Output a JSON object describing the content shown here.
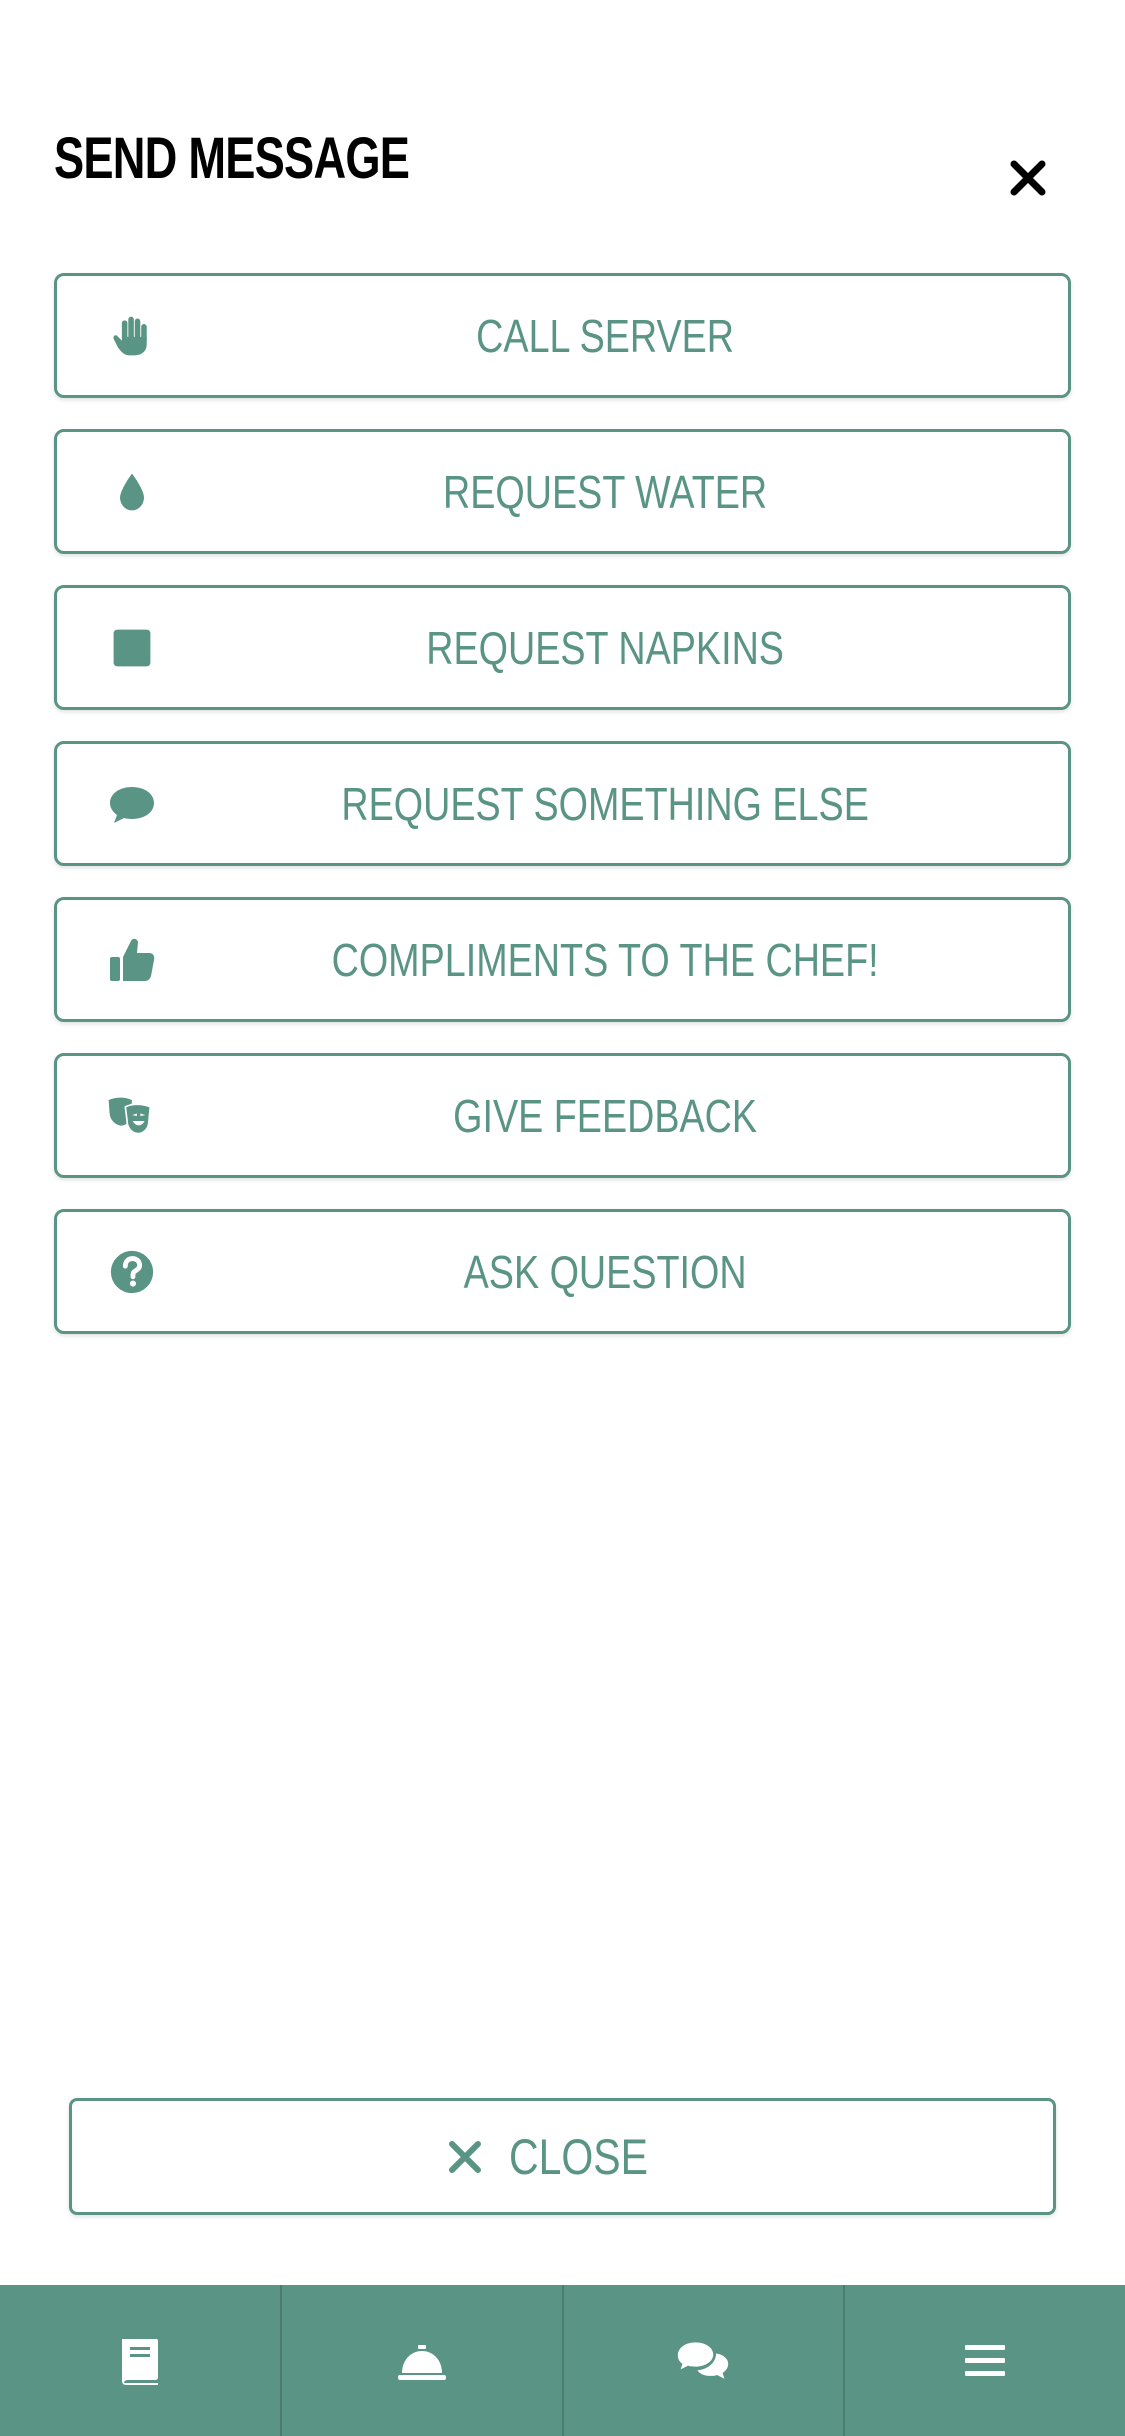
{
  "header": {
    "title": "SEND MESSAGE",
    "close_icon": "close-icon"
  },
  "options": [
    {
      "label": "CALL SERVER",
      "icon": "hand-icon"
    },
    {
      "label": "REQUEST WATER",
      "icon": "water-drop-icon"
    },
    {
      "label": "REQUEST NAPKINS",
      "icon": "napkin-icon"
    },
    {
      "label": "REQUEST SOMETHING ELSE",
      "icon": "comment-icon"
    },
    {
      "label": "COMPLIMENTS TO THE CHEF!",
      "icon": "thumbs-up-icon"
    },
    {
      "label": "GIVE FEEDBACK",
      "icon": "theater-masks-icon"
    },
    {
      "label": "ASK QUESTION",
      "icon": "question-circle-icon"
    }
  ],
  "close_button": {
    "label": "CLOSE",
    "icon": "close-icon"
  },
  "bottom_nav": [
    {
      "icon": "menu-book-icon"
    },
    {
      "icon": "service-bell-icon"
    },
    {
      "icon": "chat-bubbles-icon"
    },
    {
      "icon": "hamburger-menu-icon"
    }
  ],
  "colors": {
    "accent": "#5a9484",
    "background": "#ffffff",
    "title": "#000000"
  }
}
